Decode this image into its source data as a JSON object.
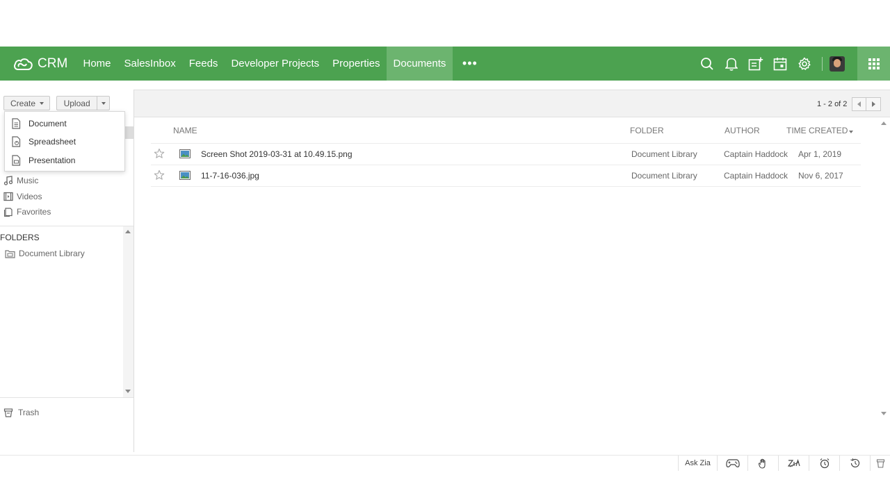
{
  "app": {
    "name": "CRM"
  },
  "nav": {
    "tabs": [
      {
        "label": "Home",
        "active": false
      },
      {
        "label": "SalesInbox",
        "active": false
      },
      {
        "label": "Feeds",
        "active": false
      },
      {
        "label": "Developer Projects",
        "active": false
      },
      {
        "label": "Properties",
        "active": false
      },
      {
        "label": "Documents",
        "active": true
      }
    ],
    "more_label": "•••",
    "right_icons": [
      "search-icon",
      "bell-icon",
      "add-activity-icon",
      "calendar-icon",
      "gear-icon"
    ],
    "accent_color": "#4ca250",
    "active_tab_color": "#6cb46f"
  },
  "left": {
    "create_label": "Create",
    "upload_label": "Upload",
    "create_menu": [
      "Document",
      "Spreadsheet",
      "Presentation"
    ],
    "categories": [
      {
        "label": "Music",
        "icon": "music-icon"
      },
      {
        "label": "Videos",
        "icon": "video-icon"
      },
      {
        "label": "Favorites",
        "icon": "favorites-icon"
      }
    ],
    "folders_title": "FOLDERS",
    "folders": [
      "Document Library"
    ],
    "trash_label": "Trash"
  },
  "main": {
    "pager": "1 - 2 of 2",
    "columns": {
      "name": "NAME",
      "folder": "FOLDER",
      "author": "AUTHOR",
      "time": "TIME CREATED"
    },
    "rows": [
      {
        "name": "Screen Shot 2019-03-31 at 10.49.15.png",
        "folder": "Document Library",
        "author": "Captain Haddock",
        "time": "Apr 1, 2019"
      },
      {
        "name": "11-7-16-036.jpg",
        "folder": "Document Library",
        "author": "Captain Haddock",
        "time": "Nov 6, 2017"
      }
    ]
  },
  "bottom": {
    "ask_zia": "Ask Zia",
    "icons": [
      "gamepad-icon",
      "hand-icon",
      "zia-icon",
      "alarm-icon",
      "history-icon",
      "recycle-icon"
    ]
  }
}
